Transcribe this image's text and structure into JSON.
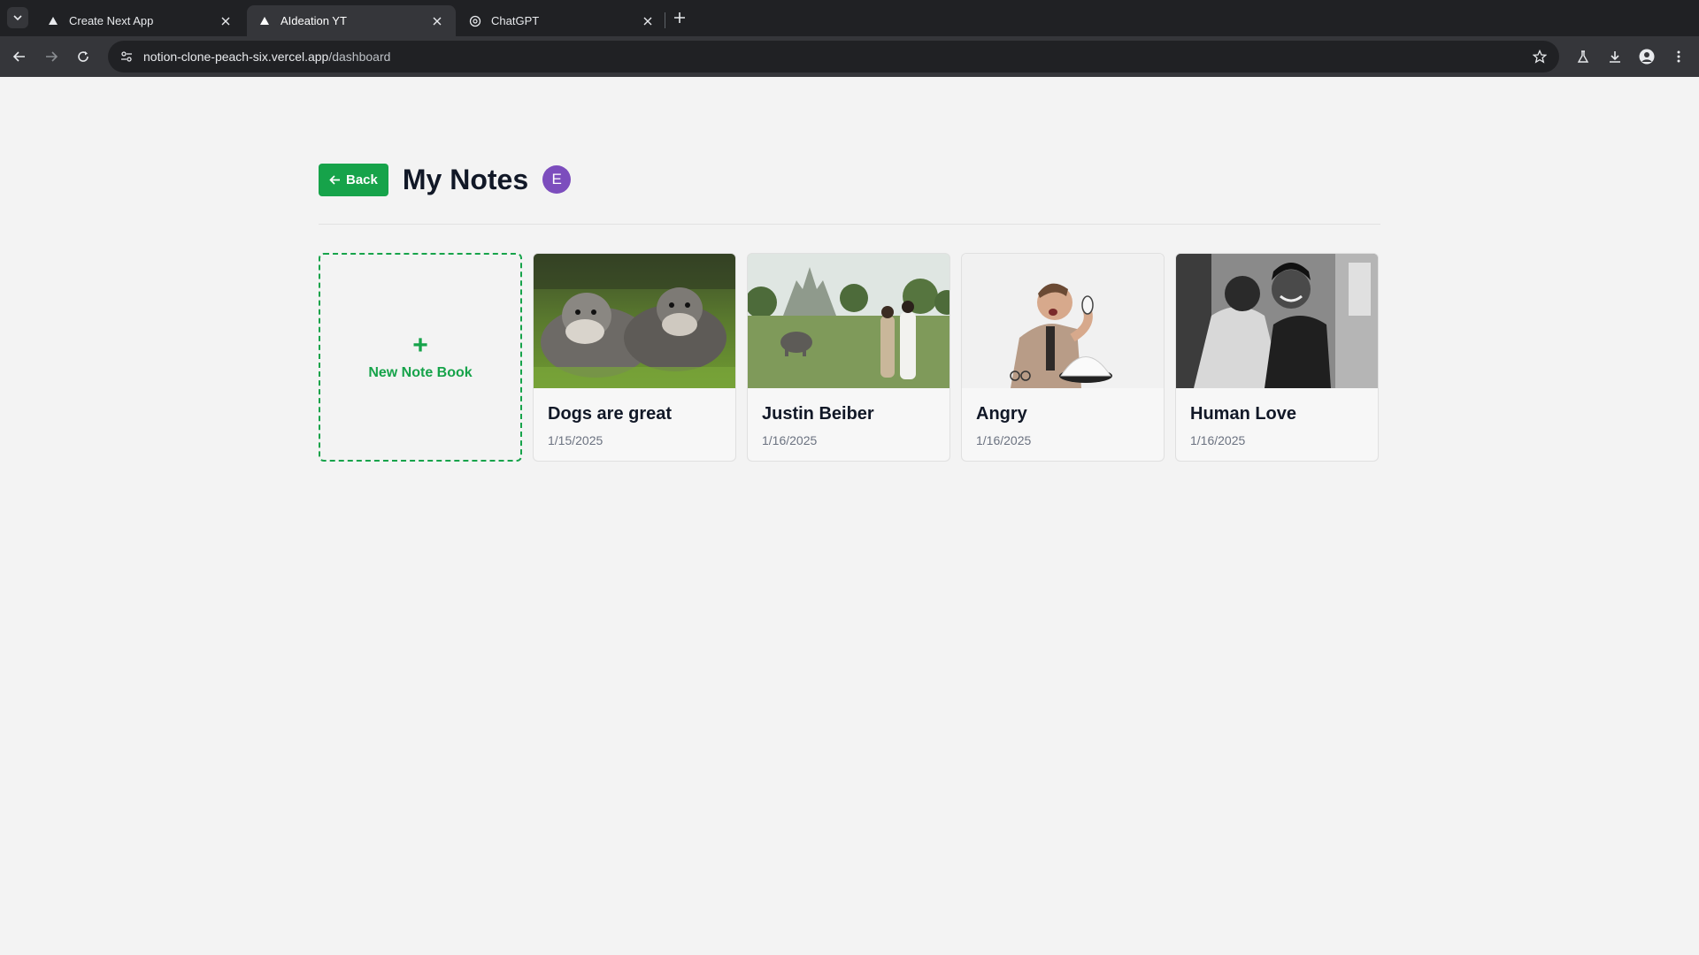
{
  "browser": {
    "tabs": [
      {
        "title": "Create Next App",
        "active": false
      },
      {
        "title": "AIdeation YT",
        "active": true
      },
      {
        "title": "ChatGPT",
        "active": false
      }
    ],
    "url_host": "notion-clone-peach-six.vercel.app",
    "url_path": "/dashboard"
  },
  "header": {
    "back_label": "Back",
    "title": "My Notes",
    "avatar_initial": "E"
  },
  "new_notebook": {
    "plus": "+",
    "label": "New Note Book"
  },
  "notes": [
    {
      "title": "Dogs are great",
      "date": "1/15/2025",
      "image": "two schnauzer dogs on grass"
    },
    {
      "title": "Justin Beiber",
      "date": "1/16/2025",
      "image": "couple with elephant near temple"
    },
    {
      "title": "Angry",
      "date": "1/16/2025",
      "image": "man shouting into telephone"
    },
    {
      "title": "Human Love",
      "date": "1/16/2025",
      "image": "black and white embracing couple"
    }
  ],
  "colors": {
    "accent": "#16a34a",
    "avatar": "#7c4dbd",
    "background": "#f3f3f3"
  }
}
